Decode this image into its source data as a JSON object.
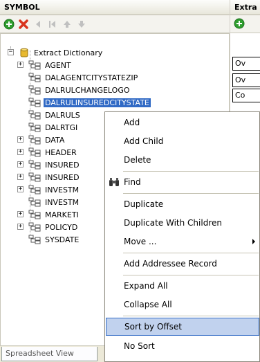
{
  "left_panel": {
    "title": "SYMBOL",
    "toolbar": {
      "buttons": [
        {
          "name": "add-button",
          "icon": "plus-circle-icon"
        },
        {
          "name": "delete-button",
          "icon": "x-icon"
        },
        {
          "name": "move-left-button",
          "icon": "arrow-left-icon"
        },
        {
          "name": "move-first-button",
          "icon": "first-icon"
        },
        {
          "name": "move-up-button",
          "icon": "arrow-up-icon"
        },
        {
          "name": "move-down-button",
          "icon": "arrow-down-icon"
        }
      ]
    },
    "tree": {
      "root_label": "Extract Dictionary",
      "items": [
        {
          "label": "AGENT",
          "expandable": true
        },
        {
          "label": "DALAGENTCITYSTATEZIP",
          "expandable": false
        },
        {
          "label": "DALRULCHANGELOGO",
          "expandable": false
        },
        {
          "label": "DALRULINSUREDCITYSTATE",
          "expandable": false,
          "selected": true
        },
        {
          "label": "DALRULS",
          "expandable": false
        },
        {
          "label": "DALRTGI",
          "expandable": false
        },
        {
          "label": "DATA",
          "expandable": true
        },
        {
          "label": "HEADER",
          "expandable": true
        },
        {
          "label": "INSURED",
          "expandable": true
        },
        {
          "label": "INSURED",
          "expandable": true
        },
        {
          "label": "INVESTM",
          "expandable": true
        },
        {
          "label": "INVESTM",
          "expandable": false
        },
        {
          "label": "MARKETI",
          "expandable": true
        },
        {
          "label": "POLICYD",
          "expandable": true
        },
        {
          "label": "SYSDATE",
          "expandable": false
        }
      ]
    },
    "bottom_tab": "Spreadsheet View"
  },
  "right_panel": {
    "title": "Extra",
    "cells": [
      "Ov",
      "Ov",
      "Co"
    ]
  },
  "context_menu": {
    "items": {
      "add": "Add",
      "add_child": "Add Child",
      "delete": "Delete",
      "find": "Find",
      "duplicate": "Duplicate",
      "duplicate_with_children": "Duplicate With Children",
      "move": "Move ...",
      "add_addressee_record": "Add Addressee Record",
      "expand_all": "Expand All",
      "collapse_all": "Collapse All",
      "sort_by_offset": "Sort by Offset",
      "no_sort": "No Sort"
    },
    "highlighted": "Sort by Offset"
  },
  "colors": {
    "selection": "#316ac5",
    "menu_highlight": "#c1d2ee",
    "add_green": "#2e9e2e",
    "delete_red": "#d8341e"
  }
}
